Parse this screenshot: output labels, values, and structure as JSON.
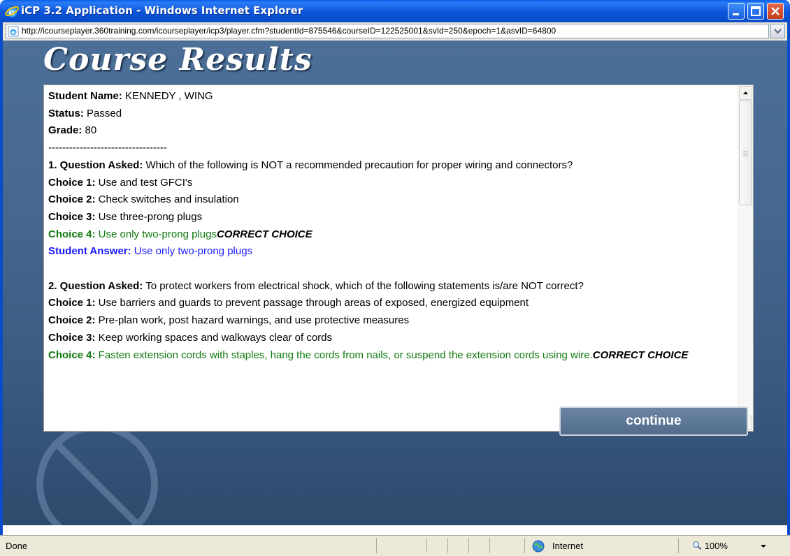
{
  "window": {
    "title": "iCP 3.2 Application - Windows Internet Explorer",
    "icon": "ie-logo-icon"
  },
  "address": {
    "url": "http://icourseplayer.360training.com/icourseplayer/icp3/player.cfm?studentId=875546&courseID=122525001&svId=250&epoch=1&asvID=64800"
  },
  "page": {
    "title": "Course Results",
    "continue_label": "continue"
  },
  "results": {
    "student_name_label": "Student Name:",
    "student_name": " KENNEDY , WING",
    "status_label": "Status:",
    "status": " Passed",
    "grade_label": "Grade:",
    "grade": " 80",
    "separator": "----------------------------------",
    "q1": {
      "label": "1. Question Asked:",
      "text": " Which of the following is NOT a recommended precaution for proper wiring and connectors?",
      "c1_label": "Choice 1:",
      "c1": " Use and test GFCI's",
      "c2_label": "Choice 2:",
      "c2": " Check switches and insulation",
      "c3_label": "Choice 3:",
      "c3": " Use three-prong plugs",
      "c4_label": "Choice 4:",
      "c4": " Use only two-prong plugs",
      "correct": "CORRECT CHOICE",
      "answer_label": "Student Answer:",
      "answer": " Use only two-prong plugs"
    },
    "q2": {
      "label": "2. Question Asked:",
      "text": " To protect workers from electrical shock, which of the following statements is/are NOT correct?",
      "c1_label": "Choice 1:",
      "c1": " Use barriers and guards to prevent passage through areas of exposed, energized equipment",
      "c2_label": "Choice 2:",
      "c2": " Pre-plan work, post hazard warnings, and use protective measures",
      "c3_label": "Choice 3:",
      "c3": " Keep working spaces and walkways clear of cords",
      "c4_label": "Choice 4:",
      "c4": " Fasten extension cords with staples, hang the cords from nails, or suspend the extension cords using wire.",
      "correct": "CORRECT CHOICE"
    }
  },
  "status_bar": {
    "status": "Done",
    "zone": "Internet",
    "zoom": "100%"
  }
}
